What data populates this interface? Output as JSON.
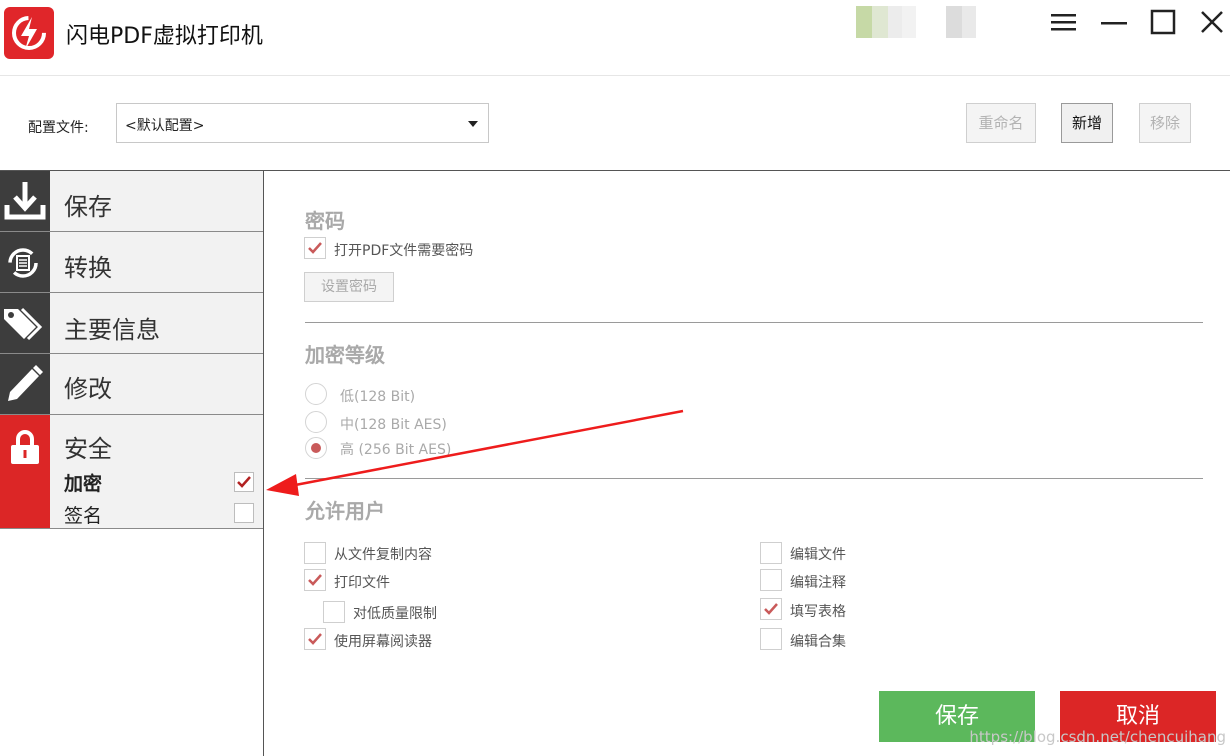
{
  "app": {
    "title": "闪电PDF虚拟打印机",
    "accent": "#dc2626"
  },
  "toolbar": {
    "config_label": "配置文件:",
    "config_value": "<默认配置>",
    "rename": "重命名",
    "add": "新增",
    "remove": "移除"
  },
  "sidebar": {
    "items": [
      {
        "label": "保存",
        "icon": "download-icon"
      },
      {
        "label": "转换",
        "icon": "convert-icon"
      },
      {
        "label": "主要信息",
        "icon": "tags-icon"
      },
      {
        "label": "修改",
        "icon": "pencil-icon"
      },
      {
        "label": "安全",
        "icon": "lock-icon"
      }
    ],
    "security_sub": [
      {
        "label": "加密",
        "checked": true
      },
      {
        "label": "签名",
        "checked": false
      }
    ]
  },
  "password": {
    "title": "密码",
    "open_requires_password": "打开PDF文件需要密码",
    "set_password": "设置密码"
  },
  "encryption": {
    "title": "加密等级",
    "options": [
      {
        "label": "低(128 Bit)",
        "selected": false
      },
      {
        "label": "中(128 Bit AES)",
        "selected": false
      },
      {
        "label": "高 (256 Bit AES)",
        "selected": true
      }
    ]
  },
  "permissions": {
    "title": "允许用户",
    "left": [
      {
        "label": "从文件复制内容",
        "checked": false
      },
      {
        "label": "打印文件",
        "checked": true
      },
      {
        "label": "对低质量限制",
        "checked": false
      },
      {
        "label": "使用屏幕阅读器",
        "checked": true
      }
    ],
    "right": [
      {
        "label": "编辑文件",
        "checked": false
      },
      {
        "label": "编辑注释",
        "checked": false
      },
      {
        "label": "填写表格",
        "checked": true
      },
      {
        "label": "编辑合集",
        "checked": false
      }
    ]
  },
  "footer": {
    "save": "保存",
    "cancel": "取消"
  },
  "watermark": "https://blog.csdn.net/chencuihang"
}
